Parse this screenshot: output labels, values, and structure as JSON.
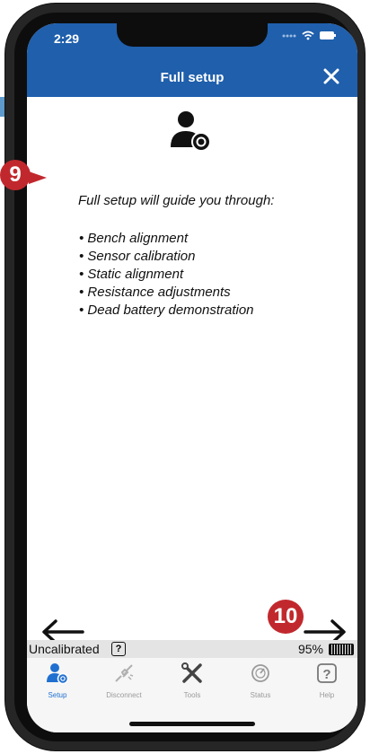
{
  "status": {
    "time": "2:29"
  },
  "header": {
    "title": "Full setup",
    "close_icon": "close-icon"
  },
  "content": {
    "intro": "Full setup will guide you through:",
    "items": [
      "Bench alignment",
      "Sensor calibration",
      "Static alignment",
      "Resistance adjustments",
      "Dead battery demonstration"
    ]
  },
  "annotations": {
    "badge_a": "9",
    "badge_b": "10"
  },
  "footer": {
    "status_text": "Uncalibrated",
    "help_glyph": "?",
    "battery_percent": "95%"
  },
  "tabs": [
    {
      "label": "Setup",
      "icon": "setup-icon",
      "active": true
    },
    {
      "label": "Disconnect",
      "icon": "disconnect-icon",
      "active": false
    },
    {
      "label": "Tools",
      "icon": "tools-icon",
      "active": false
    },
    {
      "label": "Status",
      "icon": "status-icon",
      "active": false
    },
    {
      "label": "Help",
      "icon": "help-icon",
      "active": false
    }
  ],
  "colors": {
    "header": "#1f5fac",
    "badge": "#c1282d",
    "tab_active": "#1f6fd0",
    "tab_inactive": "#9a9a9a"
  }
}
